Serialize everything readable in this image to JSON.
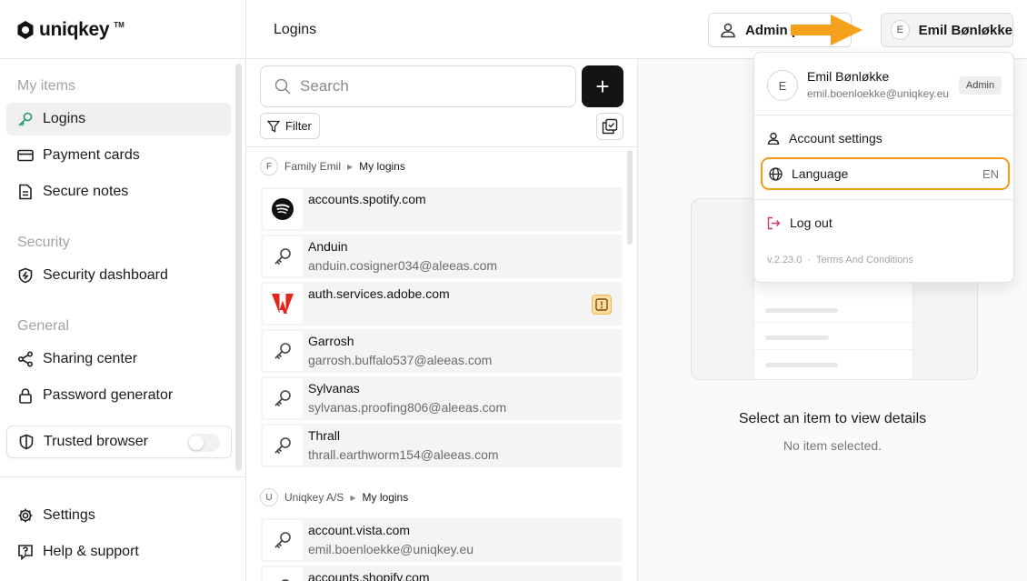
{
  "app": {
    "logo_text": "uniqkey",
    "logo_tm": "TM"
  },
  "sidebar": {
    "sections": [
      {
        "label": "My items"
      },
      {
        "label": "Security"
      },
      {
        "label": "General"
      }
    ],
    "items": [
      {
        "label": "Logins",
        "icon": "key-icon",
        "active": true
      },
      {
        "label": "Payment cards",
        "icon": "credit-card-icon"
      },
      {
        "label": "Secure notes",
        "icon": "note-icon"
      },
      {
        "label": "Security dashboard",
        "icon": "shield-bolt-icon"
      },
      {
        "label": "Sharing center",
        "icon": "share-icon"
      },
      {
        "label": "Password generator",
        "icon": "lock-icon"
      }
    ],
    "trusted_browser": {
      "label": "Trusted browser",
      "enabled": false
    },
    "bottom": [
      {
        "label": "Settings",
        "icon": "gear-icon"
      },
      {
        "label": "Help & support",
        "icon": "help-icon"
      }
    ]
  },
  "header": {
    "title": "Logins",
    "admin_button": "Admin p",
    "user_button": {
      "initial": "E",
      "name": "Emil Bønløkke"
    }
  },
  "list": {
    "search_placeholder": "Search",
    "add_label": "+",
    "filter_label": "Filter",
    "groups": [
      {
        "initial": "F",
        "owner": "Family Emil",
        "folder": "My logins",
        "items": [
          {
            "title": "accounts.spotify.com",
            "subtitle": "",
            "icon": "spotify-logo-icon"
          },
          {
            "title": "Anduin",
            "subtitle": "anduin.cosigner034@aleeas.com",
            "icon": "key-icon"
          },
          {
            "title": "auth.services.adobe.com",
            "subtitle": "",
            "icon": "adobe-logo-icon",
            "warning": true
          },
          {
            "title": "Garrosh",
            "subtitle": "garrosh.buffalo537@aleeas.com",
            "icon": "key-icon"
          },
          {
            "title": "Sylvanas",
            "subtitle": "sylvanas.proofing806@aleeas.com",
            "icon": "key-icon"
          },
          {
            "title": "Thrall",
            "subtitle": "thrall.earthworm154@aleeas.com",
            "icon": "key-icon"
          }
        ]
      },
      {
        "initial": "U",
        "owner": "Uniqkey A/S",
        "folder": "My logins",
        "items": [
          {
            "title": "account.vista.com",
            "subtitle": "emil.boenloekke@uniqkey.eu",
            "icon": "key-icon"
          },
          {
            "title": "accounts.shopify.com",
            "subtitle": "",
            "icon": "key-icon"
          }
        ]
      }
    ]
  },
  "detail": {
    "empty_title": "Select an item to view details",
    "empty_subtitle": "No item selected."
  },
  "dropdown": {
    "initial": "E",
    "name": "Emil Bønløkke",
    "email": "emil.boenloekke@uniqkey.eu",
    "badge": "Admin",
    "account_settings": "Account settings",
    "language": "Language",
    "language_code": "EN",
    "logout": "Log out",
    "version": "v.2.23.0",
    "separator": "·",
    "terms": "Terms And Conditions"
  },
  "colors": {
    "highlight": "#f39c12",
    "logout": "#d6336c",
    "dark_button": "#141414"
  }
}
